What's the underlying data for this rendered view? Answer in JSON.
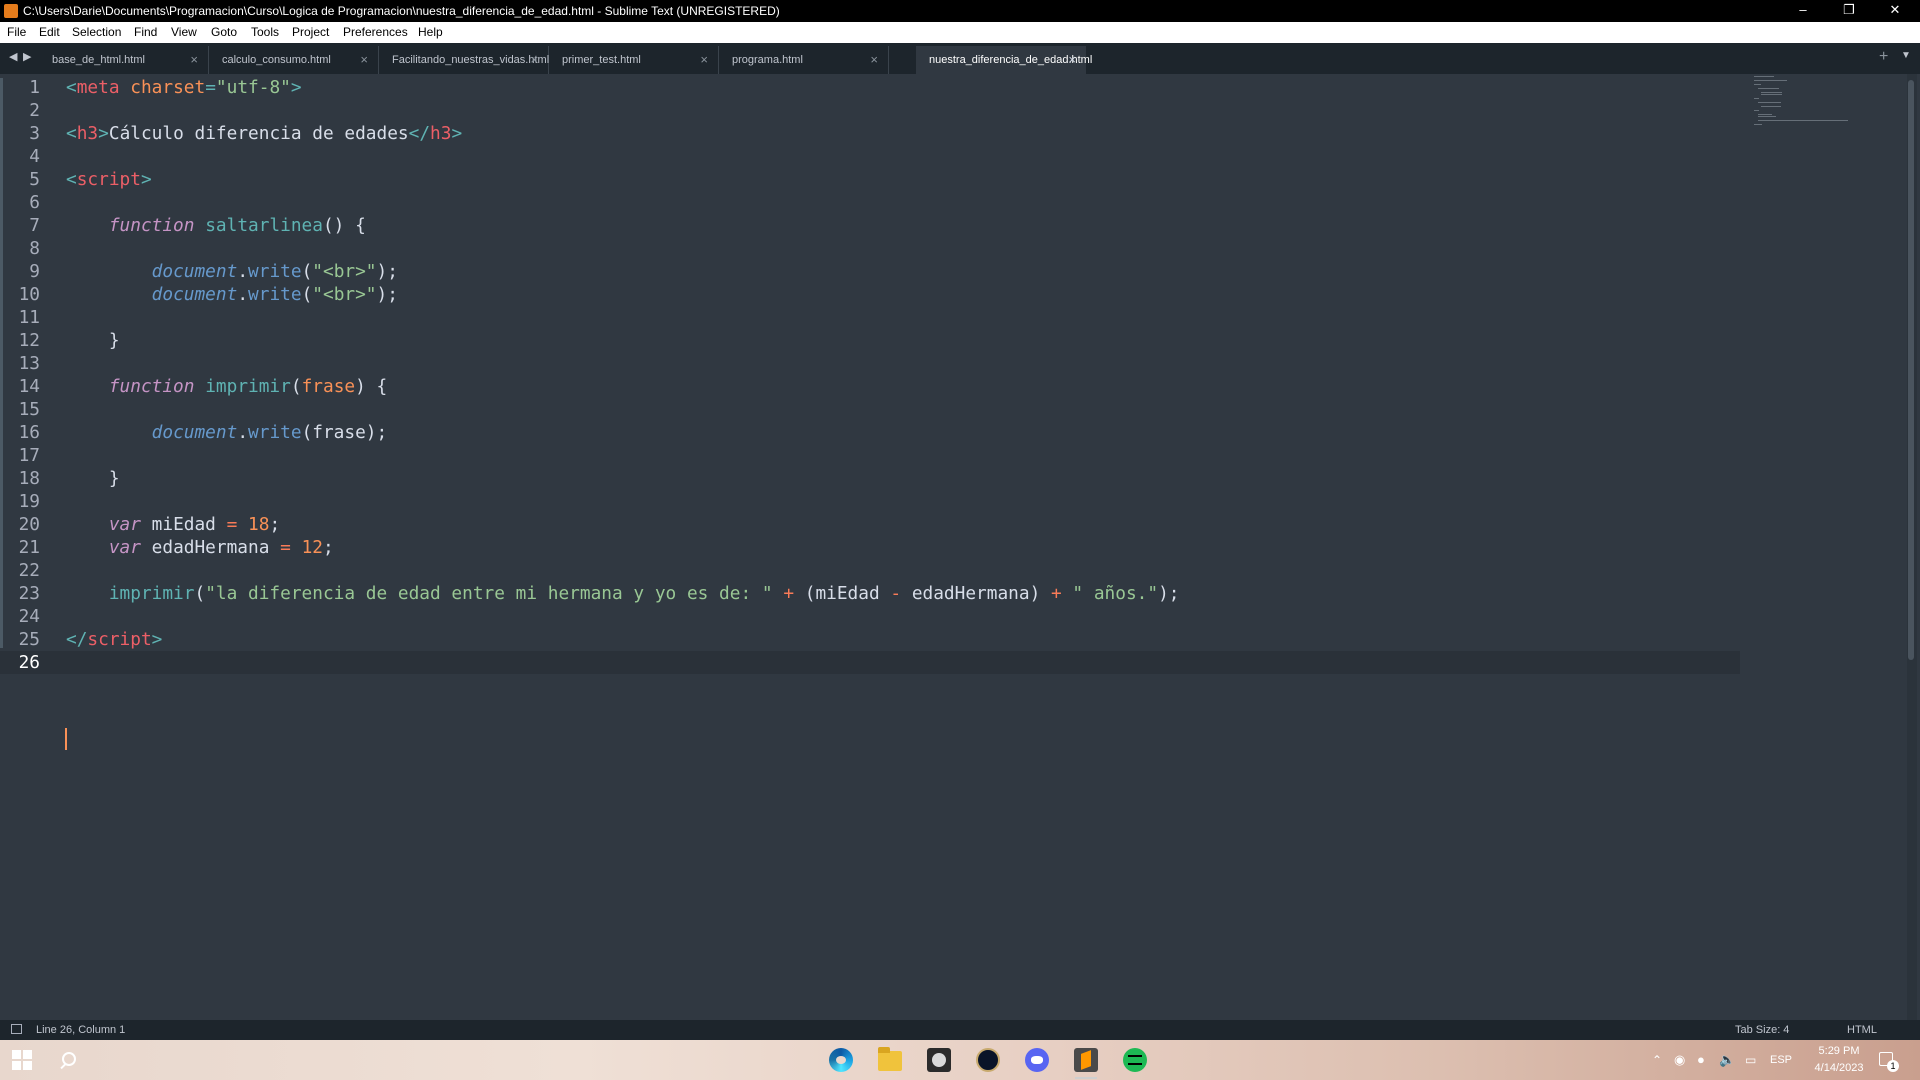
{
  "window": {
    "title": "C:\\Users\\Darie\\Documents\\Programacion\\Curso\\Logica de Programacion\\nuestra_diferencia_de_edad.html - Sublime Text (UNREGISTERED)"
  },
  "menu": [
    "File",
    "Edit",
    "Selection",
    "Find",
    "View",
    "Goto",
    "Tools",
    "Project",
    "Preferences",
    "Help"
  ],
  "tabs": [
    {
      "label": "base_de_html.html",
      "active": false
    },
    {
      "label": "calculo_consumo.html",
      "active": false
    },
    {
      "label": "Facilitando_nuestras_vidas.html",
      "active": false
    },
    {
      "label": "primer_test.html",
      "active": false
    },
    {
      "label": "programa.html",
      "active": false
    },
    {
      "label": "nuestra_diferencia_de_edad.html",
      "active": true
    }
  ],
  "editor": {
    "current_line": 26,
    "lines": [
      [
        [
          "t-punct",
          "<"
        ],
        [
          "t-tag",
          "meta"
        ],
        [
          "t-text",
          " "
        ],
        [
          "t-attr",
          "charset"
        ],
        [
          "t-punct",
          "="
        ],
        [
          "t-str",
          "\"utf-8\""
        ],
        [
          "t-punct",
          ">"
        ]
      ],
      [],
      [
        [
          "t-punct",
          "<"
        ],
        [
          "t-tag",
          "h3"
        ],
        [
          "t-punct",
          ">"
        ],
        [
          "t-text",
          "Cálculo diferencia de edades"
        ],
        [
          "t-punct",
          "</"
        ],
        [
          "t-tag",
          "h3"
        ],
        [
          "t-punct",
          ">"
        ]
      ],
      [],
      [
        [
          "t-punct",
          "<"
        ],
        [
          "t-tag",
          "script"
        ],
        [
          "t-punct",
          ">"
        ]
      ],
      [],
      [
        [
          "t-text",
          "    "
        ],
        [
          "t-kw",
          "function"
        ],
        [
          "t-text",
          " "
        ],
        [
          "t-fn",
          "saltarlinea"
        ],
        [
          "t-text",
          "() {"
        ]
      ],
      [],
      [
        [
          "t-text",
          "        "
        ],
        [
          "t-obj",
          "document"
        ],
        [
          "t-text",
          "."
        ],
        [
          "t-method",
          "write"
        ],
        [
          "t-text",
          "("
        ],
        [
          "t-str",
          "\"<br>\""
        ],
        [
          "t-text",
          ");"
        ]
      ],
      [
        [
          "t-text",
          "        "
        ],
        [
          "t-obj",
          "document"
        ],
        [
          "t-text",
          "."
        ],
        [
          "t-method",
          "write"
        ],
        [
          "t-text",
          "("
        ],
        [
          "t-str",
          "\"<br>\""
        ],
        [
          "t-text",
          ");"
        ]
      ],
      [],
      [
        [
          "t-text",
          "    }"
        ]
      ],
      [],
      [
        [
          "t-text",
          "    "
        ],
        [
          "t-kw",
          "function"
        ],
        [
          "t-text",
          " "
        ],
        [
          "t-fn",
          "imprimir"
        ],
        [
          "t-text",
          "("
        ],
        [
          "t-param",
          "frase"
        ],
        [
          "t-text",
          ") {"
        ]
      ],
      [],
      [
        [
          "t-text",
          "        "
        ],
        [
          "t-obj",
          "document"
        ],
        [
          "t-text",
          "."
        ],
        [
          "t-method",
          "write"
        ],
        [
          "t-text",
          "(frase);"
        ]
      ],
      [],
      [
        [
          "t-text",
          "    }"
        ]
      ],
      [],
      [
        [
          "t-text",
          "    "
        ],
        [
          "t-kw",
          "var"
        ],
        [
          "t-text",
          " miEdad "
        ],
        [
          "t-op",
          "="
        ],
        [
          "t-text",
          " "
        ],
        [
          "t-num",
          "18"
        ],
        [
          "t-text",
          ";"
        ]
      ],
      [
        [
          "t-text",
          "    "
        ],
        [
          "t-kw",
          "var"
        ],
        [
          "t-text",
          " edadHermana "
        ],
        [
          "t-op",
          "="
        ],
        [
          "t-text",
          " "
        ],
        [
          "t-num",
          "12"
        ],
        [
          "t-text",
          ";"
        ]
      ],
      [],
      [
        [
          "t-text",
          "    "
        ],
        [
          "t-fn",
          "imprimir"
        ],
        [
          "t-text",
          "("
        ],
        [
          "t-str",
          "\"la diferencia de edad entre mi hermana y yo es de: \""
        ],
        [
          "t-text",
          " "
        ],
        [
          "t-op",
          "+"
        ],
        [
          "t-text",
          " (miEdad "
        ],
        [
          "t-op",
          "-"
        ],
        [
          "t-text",
          " edadHermana) "
        ],
        [
          "t-op",
          "+"
        ],
        [
          "t-text",
          " "
        ],
        [
          "t-str",
          "\" años.\""
        ],
        [
          "t-text",
          ");"
        ]
      ],
      [],
      [
        [
          "t-punct",
          "</"
        ],
        [
          "t-tag",
          "script"
        ],
        [
          "t-punct",
          ">"
        ]
      ],
      []
    ]
  },
  "status": {
    "position": "Line 26, Column 1",
    "tab_size": "Tab Size: 4",
    "syntax": "HTML"
  },
  "taskbar": {
    "language": "ESP",
    "time": "5:29 PM",
    "date": "4/14/2023",
    "notifications": "1",
    "apps": [
      "edge-icon",
      "file-explorer-icon",
      "app-icon",
      "league-of-legends-icon",
      "discord-icon",
      "sublime-text-icon",
      "spotify-icon"
    ]
  }
}
